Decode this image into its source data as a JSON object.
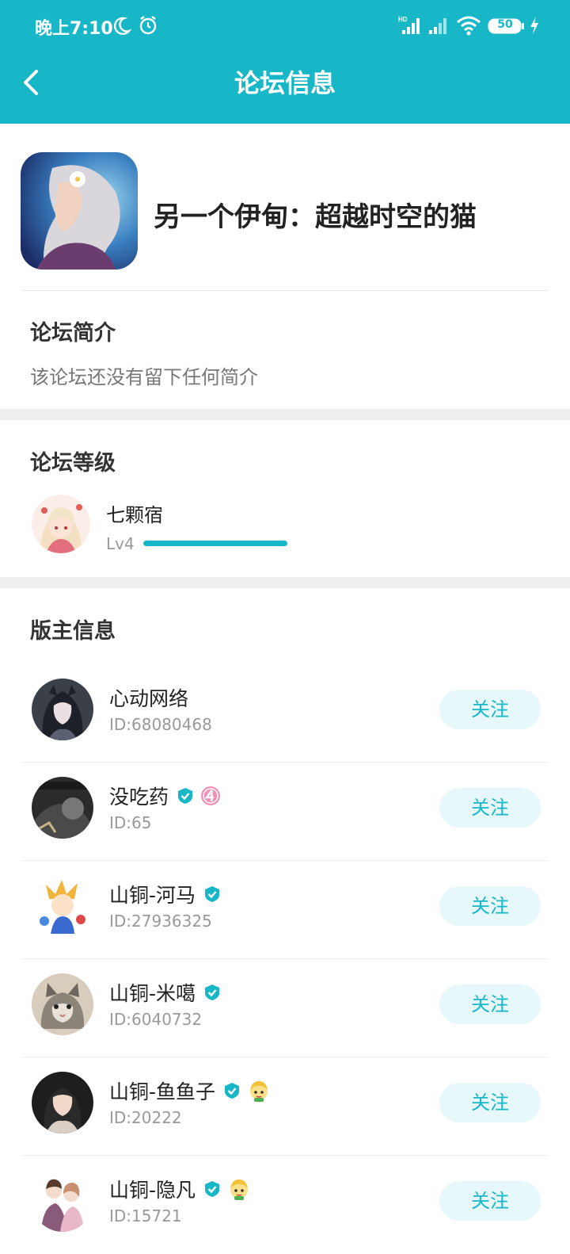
{
  "status_bar": {
    "time": "晚上7:10",
    "battery": "50"
  },
  "header": {
    "title": "论坛信息"
  },
  "forum": {
    "name": "另一个伊甸：超越时空的猫"
  },
  "intro": {
    "title": "论坛简介",
    "text": "该论坛还没有留下任何简介"
  },
  "level": {
    "title": "论坛等级",
    "name": "七颗宿",
    "lv": "Lv4",
    "progress": 1.0
  },
  "moderators": {
    "title": "版主信息",
    "follow_label": "关注",
    "items": [
      {
        "name": "心动网络",
        "id": "ID:68080468"
      },
      {
        "name": "没吃药",
        "id": "ID:65"
      },
      {
        "name": "山铜-河马",
        "id": "ID:27936325"
      },
      {
        "name": "山铜-米噶",
        "id": "ID:6040732"
      },
      {
        "name": "山铜-鱼鱼子",
        "id": "ID:20222"
      },
      {
        "name": "山铜-隐凡",
        "id": "ID:15721"
      }
    ]
  },
  "colors": {
    "accent": "#17b7c7",
    "follow_bg": "#e6f8fa"
  }
}
